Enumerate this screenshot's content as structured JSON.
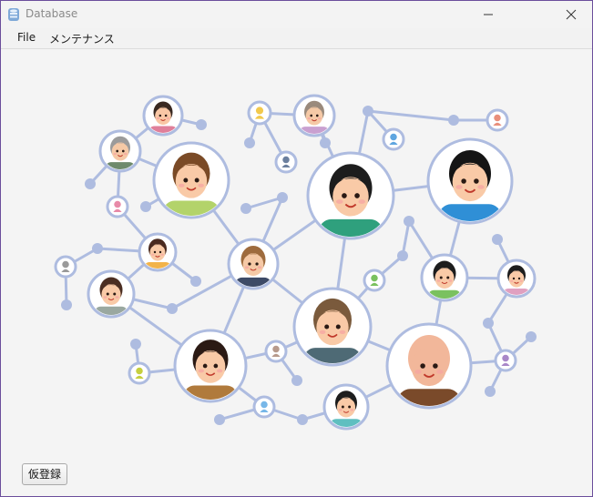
{
  "window": {
    "title": "Database",
    "accent_border": "#6b4e9b"
  },
  "menubar": {
    "items": [
      "File",
      "メンテナンス"
    ]
  },
  "actions": {
    "provisional_register": "仮登録"
  },
  "icons": {
    "app": "database-app-icon",
    "minimize": "minimize-icon",
    "close": "close-icon"
  },
  "colors": {
    "link": "#aebce0",
    "ring": "#aebce0",
    "background": "#f4f4f4"
  }
}
